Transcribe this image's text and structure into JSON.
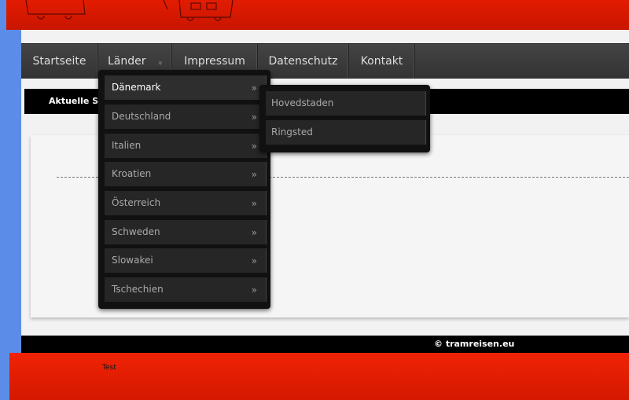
{
  "nav": {
    "items": [
      "Startseite",
      "Länder",
      "Impressum",
      "Datenschutz",
      "Kontakt"
    ],
    "laender_chevron": "»"
  },
  "breadcrumb": {
    "label": "Aktuelle Se"
  },
  "dropdown": {
    "items": [
      "Dänemark",
      "Deutschland",
      "Italien",
      "Kroatien",
      "Österreich",
      "Schweden",
      "Slowakei",
      "Tschechien"
    ],
    "arrow": "»"
  },
  "submenu": {
    "items": [
      "Hovedstaden",
      "Ringsted"
    ]
  },
  "footer": {
    "copyright": "© tramreisen.eu",
    "test_label": "Test"
  },
  "colors": {
    "header_red": "#e21c02",
    "nav_dark": "#3a3a3a",
    "page_bg": "#5b8de8"
  }
}
